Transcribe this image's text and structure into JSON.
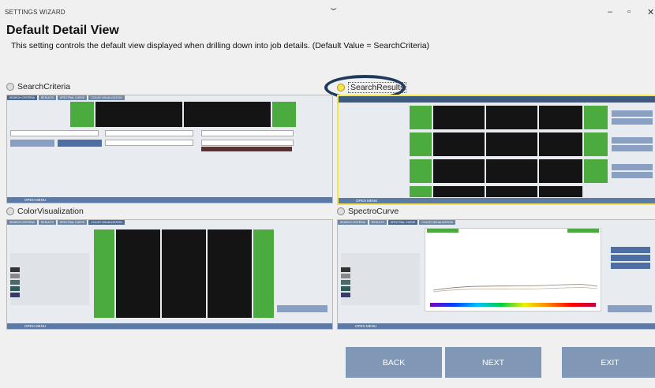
{
  "window": {
    "title": "SETTINGS WIZARD",
    "chevron": "⌄",
    "minimize": "–",
    "restore": "▫",
    "close": "✕"
  },
  "page": {
    "heading": "Default Detail View",
    "description": "This setting controls the default view displayed when drilling down into job details. (Default Value = SearchCriteria)"
  },
  "options": [
    {
      "label": "SearchCriteria",
      "selected": false
    },
    {
      "label": "SearchResults",
      "selected": true
    },
    {
      "label": "ColorVisualization",
      "selected": false
    },
    {
      "label": "SpectroCurve",
      "selected": false
    }
  ],
  "thumbnails": {
    "tabs": [
      "SEARCH CRITERIA",
      "RESULTS",
      "SPECTRAL CURVE",
      "COLOR VISUALIZATION"
    ],
    "open_menu": "OPEN MENU"
  },
  "nav": {
    "back": "BACK",
    "next": "NEXT",
    "exit": "EXIT"
  },
  "colors": {
    "accent_blue": "#8097b6",
    "highlight_ring": "#1f3a5b",
    "selection_border": "#f2e64a",
    "green_match": "#4cab3f"
  }
}
